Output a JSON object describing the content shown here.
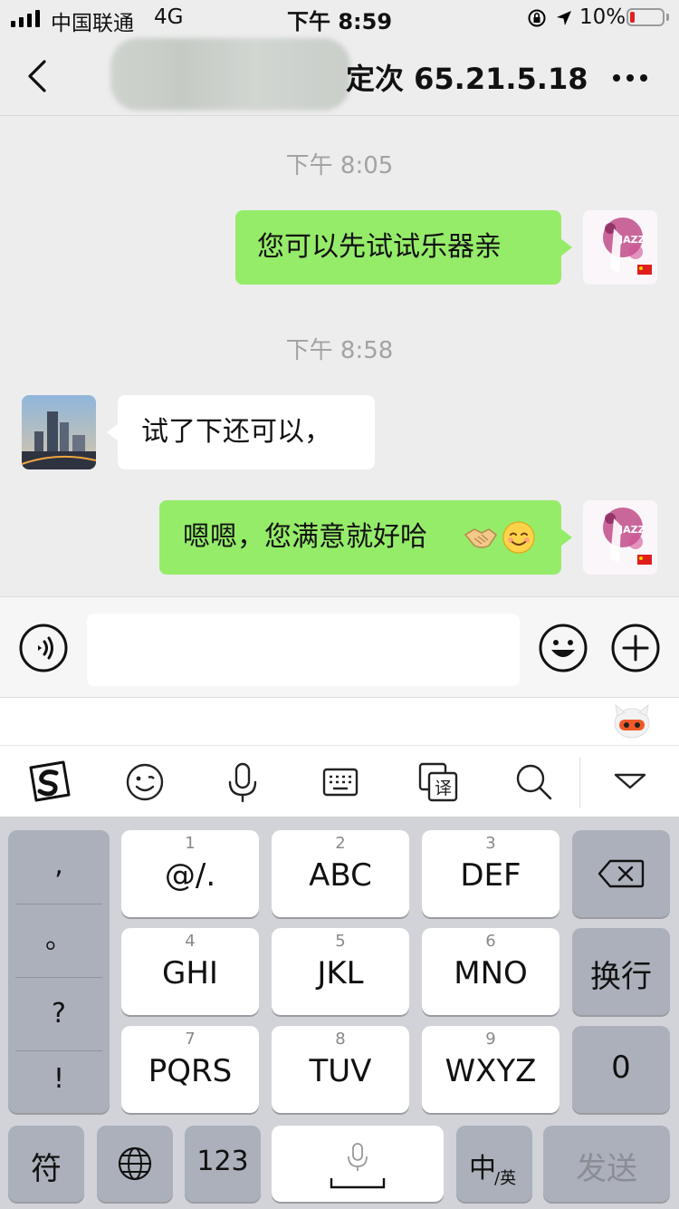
{
  "status_bar": {
    "carrier": "中国联通",
    "network": "4G",
    "time": "下午 8:59",
    "battery": "10%",
    "battery_level": 0.1
  },
  "nav": {
    "title": "定次 65.21.5.18",
    "back_icon": "chevron-left-icon",
    "more_icon": "more-dots-icon"
  },
  "messages": [
    {
      "type": "timestamp",
      "text": "下午 8:05"
    },
    {
      "type": "sent",
      "text": "您可以先试试乐器亲"
    },
    {
      "type": "timestamp",
      "text": "下午 8:58"
    },
    {
      "type": "received",
      "text": "试了下还可以，"
    },
    {
      "type": "sent",
      "text": "嗯嗯，您满意就好哈"
    }
  ],
  "input": {
    "value": "",
    "placeholder": ""
  },
  "keyboard": {
    "punct": [
      ",",
      "。",
      "?",
      "!"
    ],
    "keys": [
      {
        "num": "1",
        "label": "@/."
      },
      {
        "num": "2",
        "label": "ABC"
      },
      {
        "num": "3",
        "label": "DEF"
      },
      {
        "num": "4",
        "label": "GHI"
      },
      {
        "num": "5",
        "label": "JKL"
      },
      {
        "num": "6",
        "label": "MNO"
      },
      {
        "num": "7",
        "label": "PQRS"
      },
      {
        "num": "8",
        "label": "TUV"
      },
      {
        "num": "9",
        "label": "WXYZ"
      }
    ],
    "newline": "换行",
    "zero": "0",
    "symbols": "符",
    "num_mode": "123",
    "lang_main": "中",
    "lang_sub": "/英",
    "send": "发送"
  },
  "colors": {
    "sent_bubble": "#95ec69",
    "received_bubble": "#ffffff",
    "background": "#ededed"
  }
}
